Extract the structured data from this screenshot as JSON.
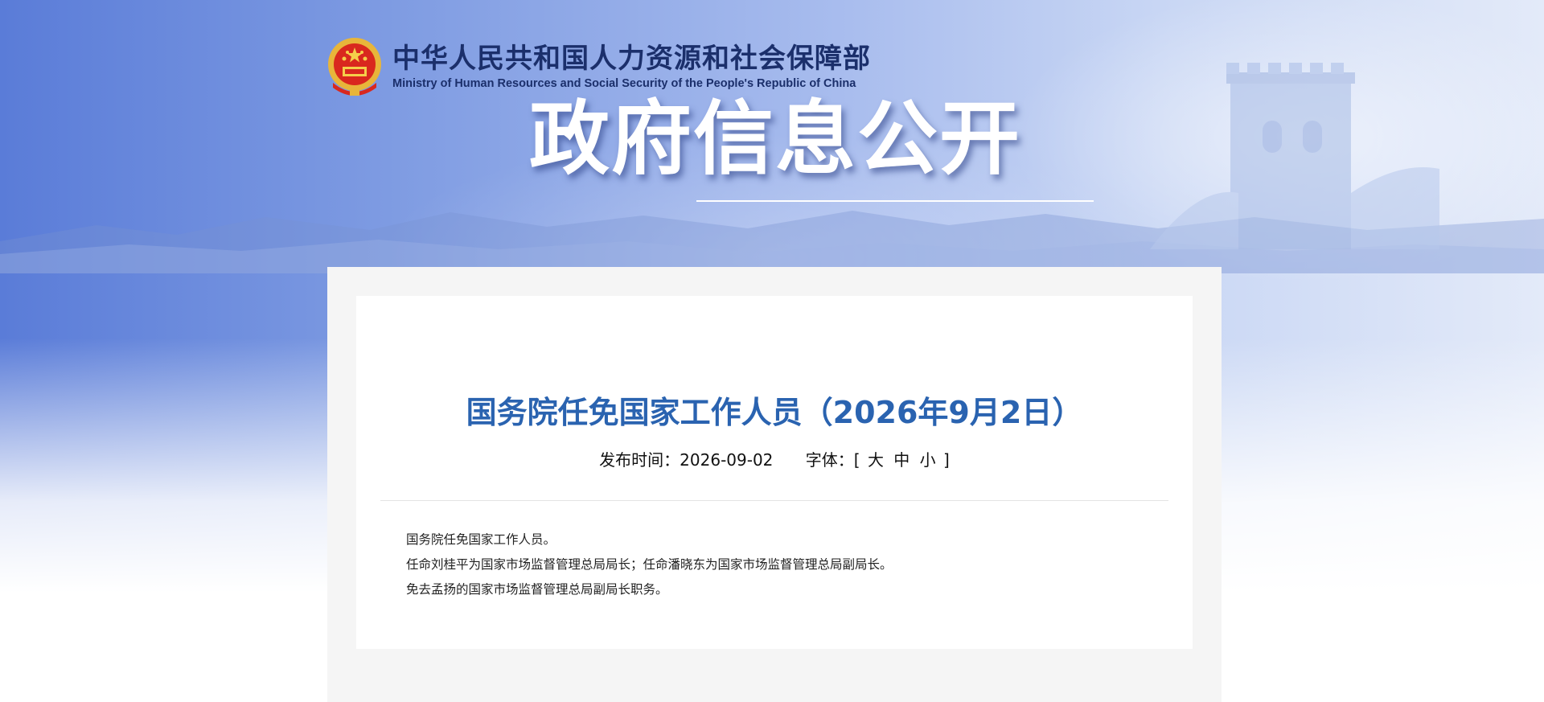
{
  "header": {
    "ministry_name_cn": "中华人民共和国人力资源和社会保障部",
    "ministry_name_en": "Ministry of Human Resources and Social Security of the People's Republic of China",
    "emblem_icon": "national-emblem-icon"
  },
  "banner": {
    "title": "政府信息公开"
  },
  "article": {
    "title": "国务院任免国家工作人员（2026年9月2日）",
    "publish_label": "发布时间：",
    "publish_date": "2026-09-02",
    "font_label": "字体：",
    "font_open": "[",
    "font_large": "大",
    "font_medium": "中",
    "font_small": "小",
    "font_close": "]",
    "paragraphs": [
      "国务院任免国家工作人员。",
      "任命刘桂平为国家市场监督管理总局局长；任命潘晓东为国家市场监督管理总局副局长。",
      "免去孟扬的国家市场监督管理总局副局长职务。"
    ]
  },
  "colors": {
    "title_blue": "#2a63b0",
    "ministry_navy": "#1b2f6b",
    "panel_gray": "#f5f5f5"
  }
}
